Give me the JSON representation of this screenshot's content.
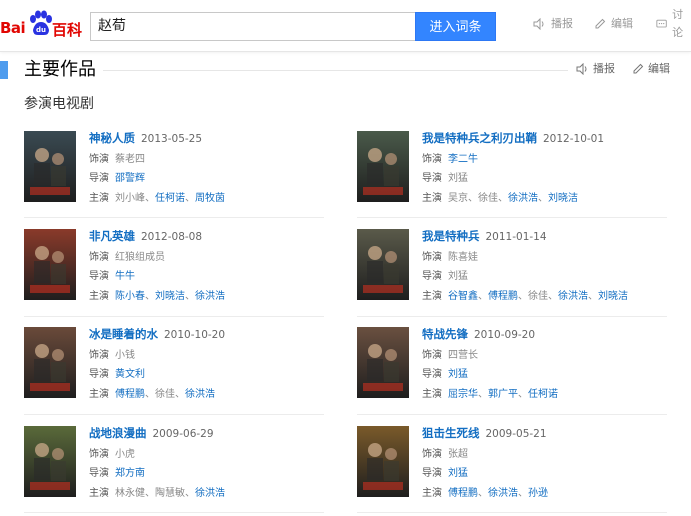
{
  "logo": {
    "part1": "Bai",
    "part2": "百科",
    "paw_text": "du"
  },
  "search": {
    "value": "赵荀",
    "button": "进入词条"
  },
  "header_actions": {
    "broadcast": "播报",
    "edit": "编辑",
    "discuss": "讨论"
  },
  "section": {
    "title": "主要作品",
    "broadcast": "播报",
    "edit": "编辑",
    "subtitle": "参演电视剧"
  },
  "labels": {
    "role": "饰演",
    "director": "导演",
    "cast": "主演"
  },
  "works": [
    {
      "title": "神秘人质",
      "date": "2013-05-25",
      "role": [
        {
          "t": "蔡老四",
          "link": false
        }
      ],
      "director": [
        {
          "t": "邵警辉",
          "link": true
        }
      ],
      "cast": [
        {
          "t": "刘小峰",
          "link": false
        },
        {
          "t": "任柯诺",
          "link": true
        },
        {
          "t": "周牧茵",
          "link": true
        }
      ],
      "poster_color": "#3a4a52"
    },
    {
      "title": "我是特种兵之利刃出鞘",
      "date": "2012-10-01",
      "role": [
        {
          "t": "李二牛",
          "link": true
        }
      ],
      "director": [
        {
          "t": "刘猛",
          "link": false
        }
      ],
      "cast": [
        {
          "t": "吴京",
          "link": false
        },
        {
          "t": "徐佳",
          "link": false
        },
        {
          "t": "徐洪浩",
          "link": true
        },
        {
          "t": "刘晓洁",
          "link": true
        }
      ],
      "poster_color": "#4a5a4a"
    },
    {
      "title": "非凡英雄",
      "date": "2012-08-08",
      "role": [
        {
          "t": "红狼组成员",
          "link": false
        }
      ],
      "director": [
        {
          "t": "牛牛",
          "link": true
        }
      ],
      "cast": [
        {
          "t": "陈小春",
          "link": true
        },
        {
          "t": "刘晓洁",
          "link": true
        },
        {
          "t": "徐洪浩",
          "link": true
        }
      ],
      "poster_color": "#8a3a2a"
    },
    {
      "title": "我是特种兵",
      "date": "2011-01-14",
      "role": [
        {
          "t": "陈喜娃",
          "link": false
        }
      ],
      "director": [
        {
          "t": "刘猛",
          "link": false
        }
      ],
      "cast": [
        {
          "t": "谷智鑫",
          "link": true
        },
        {
          "t": "傅程鹏",
          "link": true
        },
        {
          "t": "徐佳",
          "link": false
        },
        {
          "t": "徐洪浩",
          "link": true
        },
        {
          "t": "刘晓洁",
          "link": true
        }
      ],
      "poster_color": "#5a5a4a"
    },
    {
      "title": "冰是睡着的水",
      "date": "2010-10-20",
      "role": [
        {
          "t": "小钱",
          "link": false
        }
      ],
      "director": [
        {
          "t": "黄文利",
          "link": true
        }
      ],
      "cast": [
        {
          "t": "傅程鹏",
          "link": true
        },
        {
          "t": "徐佳",
          "link": false
        },
        {
          "t": "徐洪浩",
          "link": true
        }
      ],
      "poster_color": "#6a4a3a"
    },
    {
      "title": "特战先锋",
      "date": "2010-09-20",
      "role": [
        {
          "t": "四营长",
          "link": false
        }
      ],
      "director": [
        {
          "t": "刘猛",
          "link": true
        }
      ],
      "cast": [
        {
          "t": "屈宗华",
          "link": true
        },
        {
          "t": "郭广平",
          "link": true
        },
        {
          "t": "任柯诺",
          "link": true
        }
      ],
      "poster_color": "#6a5040"
    },
    {
      "title": "战地浪漫曲",
      "date": "2009-06-29",
      "role": [
        {
          "t": "小虎",
          "link": false
        }
      ],
      "director": [
        {
          "t": "郑方南",
          "link": true
        }
      ],
      "cast": [
        {
          "t": "林永健",
          "link": false
        },
        {
          "t": "陶慧敏",
          "link": false
        },
        {
          "t": "徐洪浩",
          "link": true
        }
      ],
      "poster_color": "#5a6a3a"
    },
    {
      "title": "狙击生死线",
      "date": "2009-05-21",
      "role": [
        {
          "t": "张超",
          "link": false
        }
      ],
      "director": [
        {
          "t": "刘猛",
          "link": true
        }
      ],
      "cast": [
        {
          "t": "傅程鹏",
          "link": true
        },
        {
          "t": "徐洪浩",
          "link": true
        },
        {
          "t": "孙逊",
          "link": true
        }
      ],
      "poster_color": "#7a5a2a"
    }
  ]
}
